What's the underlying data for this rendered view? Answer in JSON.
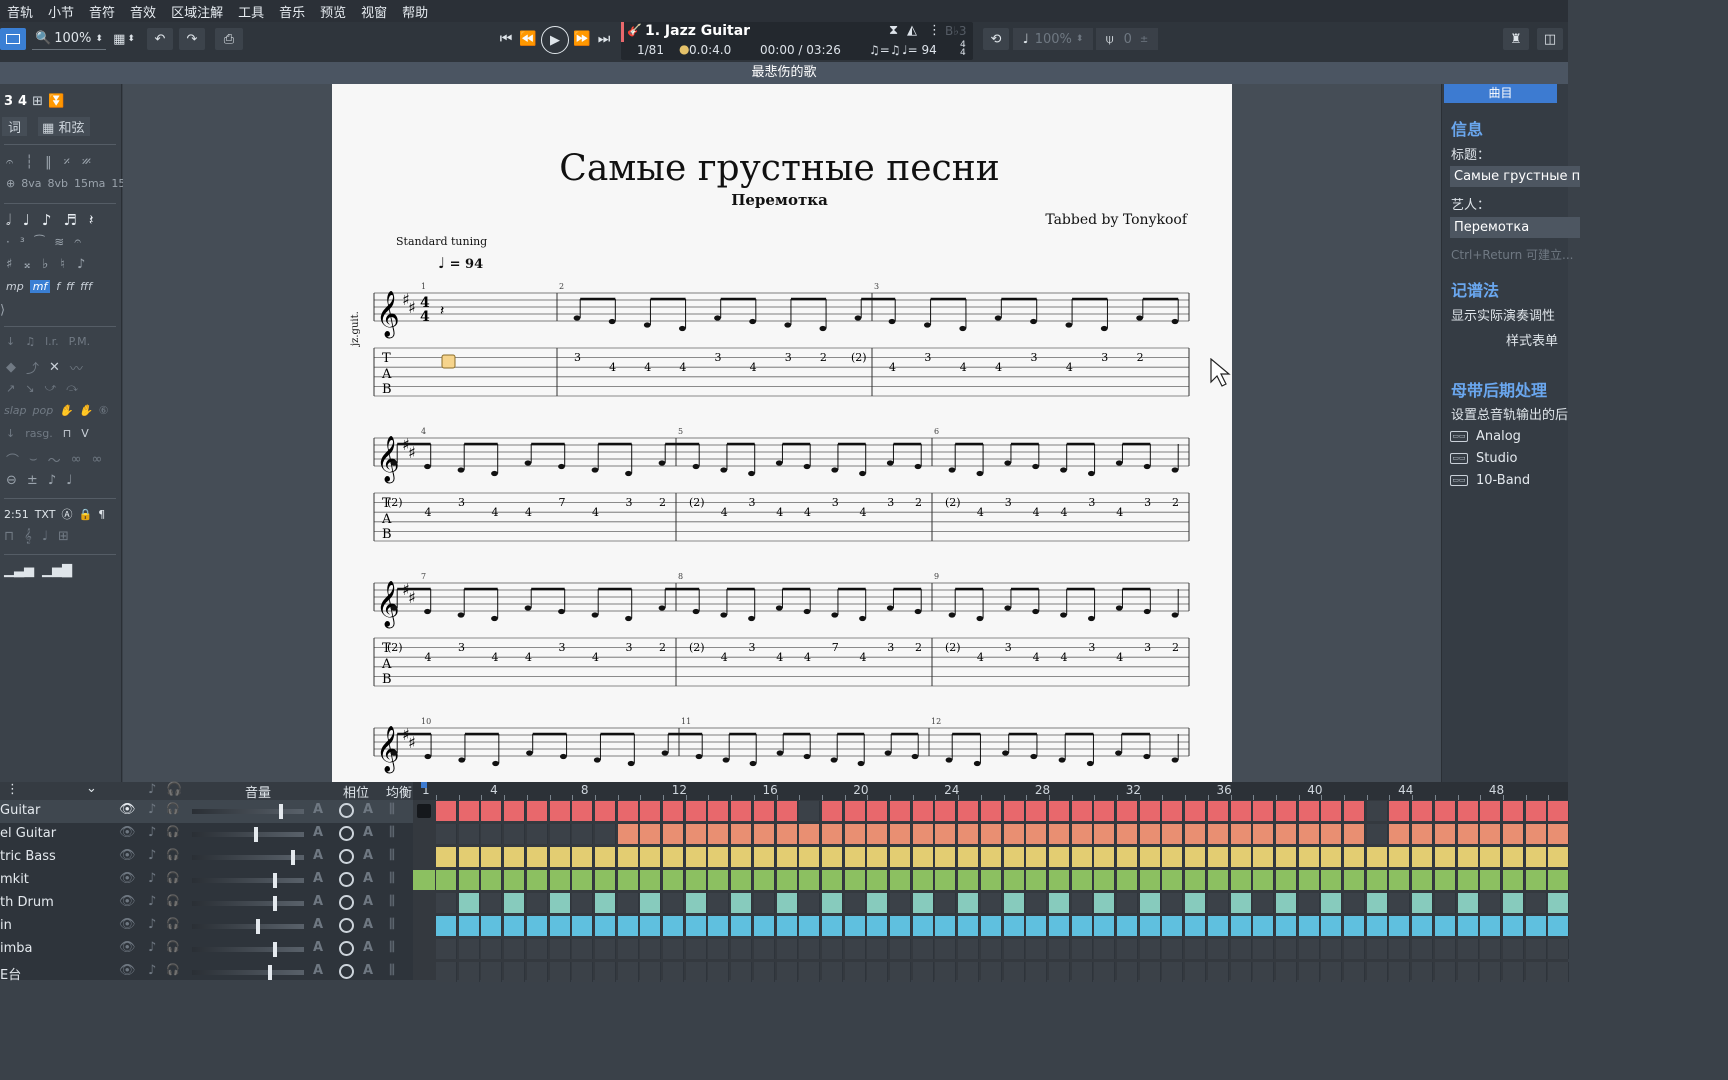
{
  "menu": [
    "音轨",
    "小节",
    "音符",
    "音效",
    "区域注解",
    "工具",
    "音乐",
    "预览",
    "视窗",
    "帮助"
  ],
  "toolbar": {
    "zoom": "100%",
    "track_name": "1. Jazz Guitar",
    "position": "1/81",
    "time_sig_pos": "0.0:4.0",
    "time": "00:00 / 03:26",
    "swing": "♫=♫",
    "tempo": "♩= 94",
    "speed": "100%",
    "count": "0",
    "key": "B♭3"
  },
  "song_title_bar": "最悲伤的歌",
  "left_panel": {
    "lyrics_label": "词",
    "chord_label": "和弦"
  },
  "score": {
    "title": "Самые грустные песни",
    "artist": "Перемотка",
    "tabber": "Tabbed by Tonykoof",
    "tuning": "Standard tuning",
    "tempo": "= 94",
    "instrument": "jz.guit.",
    "rows": [
      {
        "measure_numbers": [
          "1",
          "2",
          "3"
        ],
        "tab_numbers": [
          {
            "fret": "3",
            "string": 1
          },
          {
            "fret": "4",
            "string": 2
          },
          {
            "fret": "4",
            "string": 2
          },
          {
            "fret": "4",
            "string": 2
          },
          {
            "fret": "3",
            "string": 1
          },
          {
            "fret": "4",
            "string": 2
          },
          {
            "fret": "3",
            "string": 1
          },
          {
            "fret": "2",
            "string": 1
          },
          {
            "fret": "(2)",
            "string": 1
          },
          {
            "fret": "4",
            "string": 2
          },
          {
            "fret": "3",
            "string": 1
          },
          {
            "fret": "4",
            "string": 2
          },
          {
            "fret": "4",
            "string": 2
          },
          {
            "fret": "3",
            "string": 1
          },
          {
            "fret": "4",
            "string": 2
          },
          {
            "fret": "3",
            "string": 1
          },
          {
            "fret": "2",
            "string": 1
          }
        ]
      },
      {
        "measure_numbers": [
          "4",
          "5",
          "6"
        ],
        "tab_numbers": [
          {
            "fret": "(2)",
            "string": 1
          },
          {
            "fret": "4",
            "string": 2
          },
          {
            "fret": "3",
            "string": 1
          },
          {
            "fret": "4",
            "string": 2
          },
          {
            "fret": "4",
            "string": 2
          },
          {
            "fret": "7",
            "string": 1
          },
          {
            "fret": "4",
            "string": 2
          },
          {
            "fret": "3",
            "string": 1
          },
          {
            "fret": "2",
            "string": 1
          },
          {
            "fret": "(2)",
            "string": 1
          },
          {
            "fret": "4",
            "string": 2
          },
          {
            "fret": "3",
            "string": 1
          },
          {
            "fret": "4",
            "string": 2
          },
          {
            "fret": "4",
            "string": 2
          },
          {
            "fret": "3",
            "string": 1
          },
          {
            "fret": "4",
            "string": 2
          },
          {
            "fret": "3",
            "string": 1
          },
          {
            "fret": "2",
            "string": 1
          },
          {
            "fret": "(2)",
            "string": 1
          },
          {
            "fret": "4",
            "string": 2
          },
          {
            "fret": "3",
            "string": 1
          },
          {
            "fret": "4",
            "string": 2
          },
          {
            "fret": "4",
            "string": 2
          },
          {
            "fret": "3",
            "string": 1
          },
          {
            "fret": "4",
            "string": 2
          },
          {
            "fret": "3",
            "string": 1
          },
          {
            "fret": "2",
            "string": 1
          }
        ]
      },
      {
        "measure_numbers": [
          "7",
          "8",
          "9"
        ],
        "tab_numbers": [
          {
            "fret": "(2)",
            "string": 1
          },
          {
            "fret": "4",
            "string": 2
          },
          {
            "fret": "3",
            "string": 1
          },
          {
            "fret": "4",
            "string": 2
          },
          {
            "fret": "4",
            "string": 2
          },
          {
            "fret": "3",
            "string": 1
          },
          {
            "fret": "4",
            "string": 2
          },
          {
            "fret": "3",
            "string": 1
          },
          {
            "fret": "2",
            "string": 1
          },
          {
            "fret": "(2)",
            "string": 1
          },
          {
            "fret": "4",
            "string": 2
          },
          {
            "fret": "3",
            "string": 1
          },
          {
            "fret": "4",
            "string": 2
          },
          {
            "fret": "4",
            "string": 2
          },
          {
            "fret": "7",
            "string": 1
          },
          {
            "fret": "4",
            "string": 2
          },
          {
            "fret": "3",
            "string": 1
          },
          {
            "fret": "2",
            "string": 1
          },
          {
            "fret": "(2)",
            "string": 1
          },
          {
            "fret": "4",
            "string": 2
          },
          {
            "fret": "3",
            "string": 1
          },
          {
            "fret": "4",
            "string": 2
          },
          {
            "fret": "4",
            "string": 2
          },
          {
            "fret": "3",
            "string": 1
          },
          {
            "fret": "4",
            "string": 2
          },
          {
            "fret": "3",
            "string": 1
          },
          {
            "fret": "2",
            "string": 1
          }
        ]
      },
      {
        "measure_numbers": [
          "10",
          "11",
          "12"
        ],
        "tab_numbers": []
      }
    ]
  },
  "right_panel": {
    "tab": "曲目",
    "info_heading": "信息",
    "title_label": "标题：",
    "title_value": "Самые грустные п",
    "artist_label": "艺人：",
    "artist_value": "Перемотка",
    "hint": "Ctrl+Return 可建立...",
    "notation_heading": "记谱法",
    "notation_item": "显示实际演奏调性",
    "style_item": "样式表单",
    "master_heading": "母带后期处理",
    "master_desc": "设置总音轨输出的后",
    "fx": [
      "Analog",
      "Studio",
      "10-Band"
    ]
  },
  "track_panel": {
    "volume_label": "音量",
    "pan_label": "相位",
    "eq_label": "均衡",
    "tracks": [
      {
        "name": "Guitar",
        "color": "#e8686c",
        "vol": 0.78,
        "start": 0
      },
      {
        "name": "el Guitar",
        "color": "#e98f72",
        "vol": 0.55,
        "start": 8
      },
      {
        "name": "tric Bass",
        "color": "#e3cd72",
        "vol": 0.88,
        "start": 0
      },
      {
        "name": "mkit",
        "color": "#8cc061",
        "vol": 0.72,
        "start": -1
      },
      {
        "name": "th Drum",
        "color": "#87cbbd",
        "vol": 0.72,
        "start": 0
      },
      {
        "name": "in",
        "color": "#5fc0df",
        "vol": 0.57,
        "start": 0
      },
      {
        "name": "imba",
        "color": "#e8686c",
        "vol": 0.72,
        "start": 99
      },
      {
        "name": "E台",
        "color": "#aaaaaa",
        "vol": 0.68,
        "start": 99
      }
    ],
    "ruler": [
      "1",
      "4",
      "8",
      "12",
      "16",
      "20",
      "24",
      "28",
      "32",
      "36",
      "40",
      "44",
      "48"
    ]
  }
}
